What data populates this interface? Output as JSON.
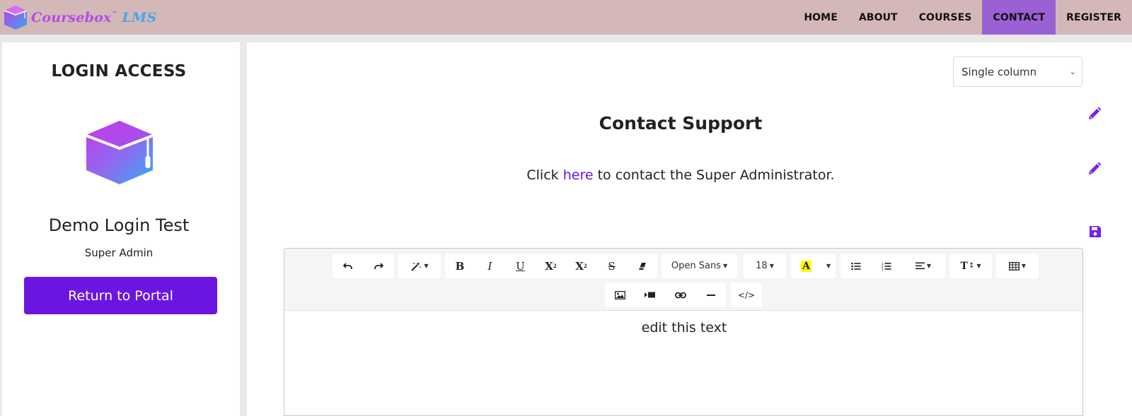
{
  "brand": {
    "name_part1": "Coursebox",
    "trademark": "™",
    "name_part2": "LMS"
  },
  "nav": {
    "items": [
      {
        "label": "HOME",
        "active": false
      },
      {
        "label": "ABOUT",
        "active": false
      },
      {
        "label": "COURSES",
        "active": false
      },
      {
        "label": "CONTACT",
        "active": true
      },
      {
        "label": "REGISTER",
        "active": false
      }
    ]
  },
  "login": {
    "title": "LOGIN ACCESS",
    "user_name": "Demo Login Test",
    "user_role": "Super Admin",
    "portal_button": "Return to Portal"
  },
  "main": {
    "layout_select": {
      "value": "Single column",
      "options": [
        "Single column"
      ]
    },
    "contact_title": "Contact Support",
    "contact_prefix": "Click ",
    "contact_link": "here",
    "contact_suffix": " to contact the Super Administrator."
  },
  "editor": {
    "font_name": "Open Sans",
    "font_size": "18",
    "content": "edit this text",
    "icons": [
      "undo-icon",
      "redo-icon",
      "magic-icon",
      "bold-icon",
      "italic-icon",
      "underline-icon",
      "superscript-icon",
      "subscript-icon",
      "strikethrough-icon",
      "eraser-icon",
      "highlight-icon",
      "unordered-list-icon",
      "ordered-list-icon",
      "align-icon",
      "text-height-icon",
      "table-icon",
      "image-icon",
      "video-icon",
      "link-icon",
      "horizontal-rule-icon",
      "code-view-icon"
    ]
  },
  "colors": {
    "navbar": "#d4b8b8",
    "nav_active": "#9a60d4",
    "primary": "#6a16e0",
    "icon_purple": "#7a1fe6",
    "logo_gradient_start": "#c43ae8",
    "logo_gradient_end": "#3aa8ef"
  }
}
